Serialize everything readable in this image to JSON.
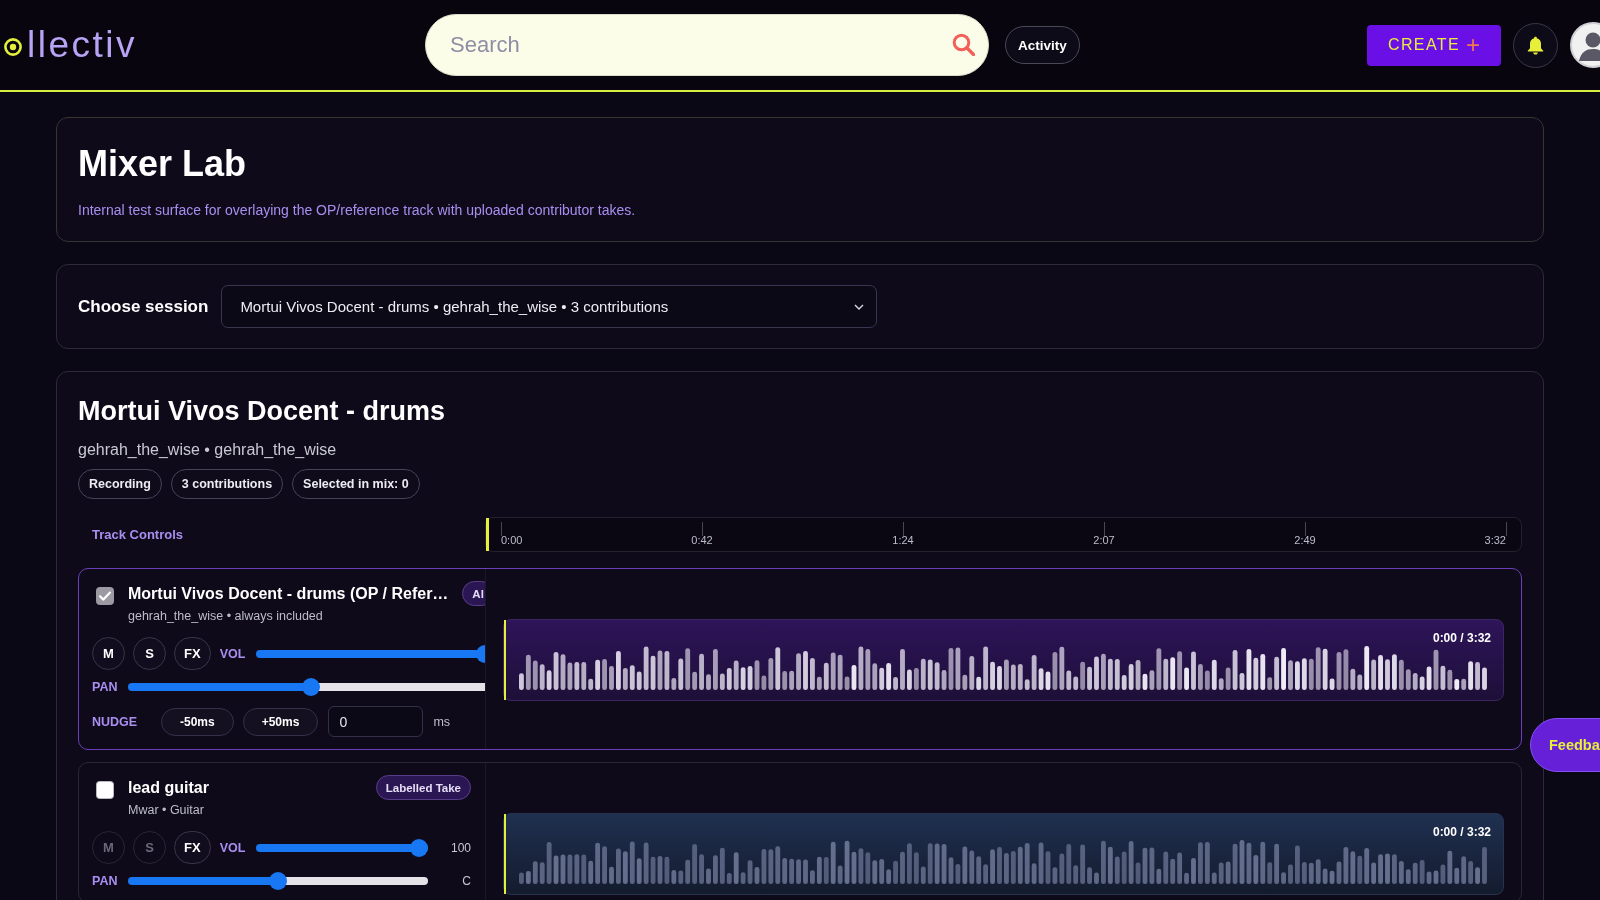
{
  "header": {
    "logo": "llectiv",
    "search": {
      "placeholder": "Search"
    },
    "activity_button": "Activity",
    "create_button": {
      "label": "CREATE",
      "icon": "+"
    }
  },
  "intro": {
    "title": "Mixer Lab",
    "description": "Internal test surface for overlaying the OP/reference track with uploaded contributor takes."
  },
  "session_picker": {
    "label": "Choose session",
    "value": "Mortui Vivos Docent - drums • gehrah_the_wise • 3 contributions"
  },
  "session": {
    "title": "Mortui Vivos Docent - drums",
    "subtitle": "gehrah_the_wise • gehrah_the_wise",
    "chips": [
      "Recording",
      "3 contributions",
      "Selected in mix: 0"
    ],
    "track_controls_label": "Track Controls",
    "timeline": {
      "ticks": [
        "0:00",
        "0:42",
        "1:24",
        "2:07",
        "2:49",
        "3:32"
      ]
    },
    "tracks": [
      {
        "kind": "reference",
        "title": "Mortui Vivos Docent - drums (OP / Refer…",
        "subtitle": "gehrah_the_wise • always included",
        "badge": "Al",
        "checked": true,
        "disabled": true,
        "buttons": [
          {
            "label": "M",
            "disabled": false
          },
          {
            "label": "S",
            "disabled": false
          },
          {
            "label": "FX",
            "disabled": false
          }
        ],
        "volume": {
          "label": "VOL",
          "level": 1
        },
        "pan": {
          "label": "PAN",
          "level": 0.5
        },
        "nudge": {
          "label": "NUDGE",
          "buttons": [
            "-50ms",
            "+50ms"
          ],
          "value": "0",
          "unit": "ms"
        },
        "time": "0:00 / 3:32"
      },
      {
        "kind": "contribution",
        "title": "lead guitar",
        "subtitle": "Mwar • Guitar",
        "badge": "Labelled Take",
        "checked": false,
        "disabled": false,
        "buttons": [
          {
            "label": "M",
            "disabled": true
          },
          {
            "label": "S",
            "disabled": true
          },
          {
            "label": "FX",
            "disabled": false
          }
        ],
        "volume": {
          "label": "VOL",
          "level": 1,
          "reading": "100"
        },
        "pan": {
          "label": "PAN",
          "level": 0.5,
          "reading": "C"
        },
        "time": "0:00 / 3:32"
      }
    ]
  },
  "feedback_button": "Feedba"
}
